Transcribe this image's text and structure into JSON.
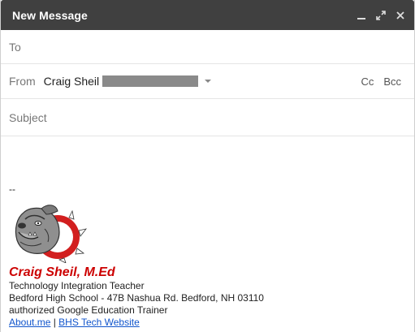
{
  "window": {
    "title": "New Message",
    "controls": [
      "minimize-icon",
      "expand-icon",
      "close-icon"
    ]
  },
  "to": {
    "label": "To",
    "value": ""
  },
  "from": {
    "label": "From",
    "sender_name": "Craig Sheil",
    "cc_label": "Cc",
    "bcc_label": "Bcc"
  },
  "subject": {
    "placeholder": "Subject",
    "value": ""
  },
  "signature": {
    "separator": "--",
    "name": "Craig Sheil, M.Ed",
    "line1": "Technology Integration Teacher",
    "line2": "Bedford High School - 47B Nashua Rd. Bedford, NH 03110",
    "line3": "authorized Google Education Trainer",
    "link1": "About.me",
    "link_sep": " | ",
    "link2": "BHS Tech Website"
  },
  "colors": {
    "titlebar": "#404040",
    "signature_name": "#cc0000",
    "link": "#1155cc"
  }
}
